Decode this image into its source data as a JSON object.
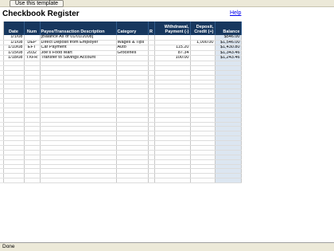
{
  "toolbar": {
    "use_template_label": "Use this template"
  },
  "sheet": {
    "title": "Checkbook Register",
    "help_label": "Help",
    "columns": {
      "date": "Date",
      "num": "Num",
      "payee": "Payee/Transaction Description",
      "category": "Category",
      "r": "R",
      "withdrawal": "Withdrawal, Payment (-)",
      "deposit": "Deposit, Credit (+)",
      "balance": "Balance"
    },
    "rows": [
      {
        "date": "1/1/08",
        "num": "",
        "payee": "[Balance As of 01/01/2008]",
        "category": "",
        "r": "",
        "withdrawal": "",
        "deposit": "",
        "balance": "$546.00"
      },
      {
        "date": "1/1/08",
        "num": "DEP",
        "payee": "Direct Deposit from Employer",
        "category": "Wages & Tips",
        "r": "",
        "withdrawal": "",
        "deposit": "1,000.00",
        "balance": "$1,546.00"
      },
      {
        "date": "1/10/08",
        "num": "EFT",
        "payee": "Car Payment",
        "category": "Auto",
        "r": "",
        "withdrawal": "115.20",
        "deposit": "",
        "balance": "$1,430.80"
      },
      {
        "date": "1/15/08",
        "num": "2032",
        "payee": "Joe's Food Mart",
        "category": "Groceries",
        "r": "",
        "withdrawal": "87.34",
        "deposit": "",
        "balance": "$1,343.46"
      },
      {
        "date": "1/18/08",
        "num": "TXFR",
        "payee": "Transfer to Savings Account",
        "category": "",
        "r": "",
        "withdrawal": "100.00",
        "deposit": "",
        "balance": "$1,243.46"
      }
    ],
    "empty_row_count": 26
  },
  "status_bar": {
    "text": "Done"
  },
  "colors": {
    "header_bg": "#17375e",
    "balance_bg": "#dce6f1"
  }
}
